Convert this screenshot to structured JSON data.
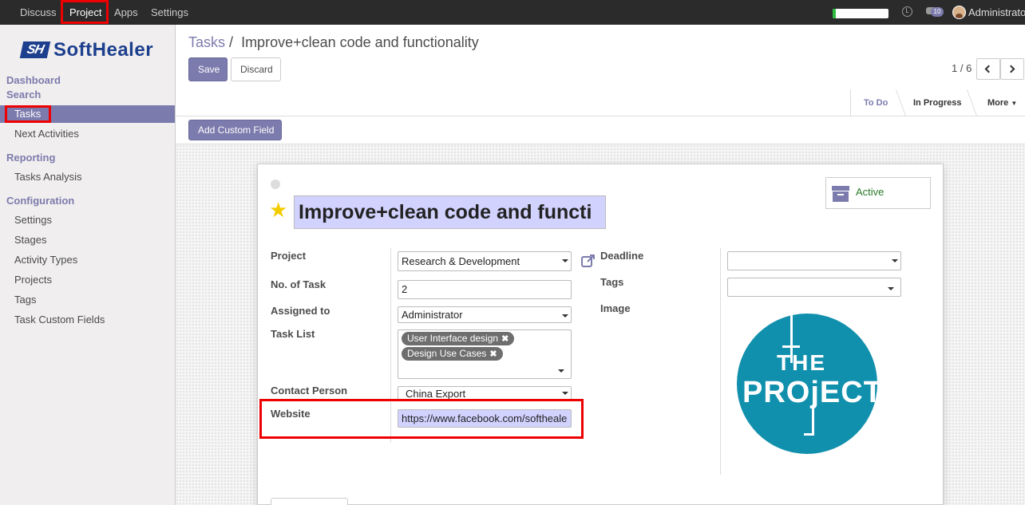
{
  "topbar": {
    "menus": [
      "Discuss",
      "Project",
      "Apps",
      "Settings"
    ],
    "notification_count": "10",
    "user_name": "Administrator",
    "progress_fraction": 0.06
  },
  "sidebar": {
    "logo_mark": "SH",
    "logo_text": "SoftHealer",
    "sections": [
      {
        "title": "Dashboard"
      },
      {
        "title": "Search",
        "items": [
          "Tasks",
          "Next Activities"
        ]
      },
      {
        "title": "Reporting",
        "items": [
          "Tasks Analysis"
        ]
      },
      {
        "title": "Configuration",
        "items": [
          "Settings",
          "Stages",
          "Activity Types",
          "Projects",
          "Tags",
          "Task Custom Fields"
        ]
      }
    ],
    "active_item": "Tasks"
  },
  "breadcrumb": {
    "parent": "Tasks",
    "separator": "/",
    "current": "Improve+clean code and functionality"
  },
  "buttons": {
    "save": "Save",
    "discard": "Discard",
    "add_custom_field": "Add Custom Field"
  },
  "pager": {
    "value": "1 / 6"
  },
  "statusbar": {
    "stages": [
      "To Do",
      "In Progress"
    ],
    "more": "More"
  },
  "form": {
    "title": "Improve+clean code and functi",
    "status": "Active",
    "left_fields": {
      "project": {
        "label": "Project",
        "value": "Research & Development"
      },
      "no_of_task": {
        "label": "No. of Task",
        "value": "2"
      },
      "assigned_to": {
        "label": "Assigned to",
        "value": "Administrator"
      },
      "task_list": {
        "label": "Task List",
        "tags": [
          "User Interface design",
          "Design Use Cases"
        ]
      },
      "contact_person": {
        "label": "Contact Person",
        "value": "China Export"
      },
      "website": {
        "label": "Website",
        "value": "https://www.facebook.com/softheale"
      }
    },
    "right_fields": {
      "deadline": {
        "label": "Deadline",
        "value": ""
      },
      "tags": {
        "label": "Tags",
        "value": ""
      },
      "image": {
        "label": "Image"
      }
    },
    "image_text": {
      "line1": "THE",
      "line2": "PROjECT"
    }
  },
  "colors": {
    "accent": "#7c7bad",
    "topbar": "#2b2b2b",
    "highlight": "#ee0000",
    "logo_blue": "#1d3f8e",
    "project_teal": "#1190ad"
  }
}
